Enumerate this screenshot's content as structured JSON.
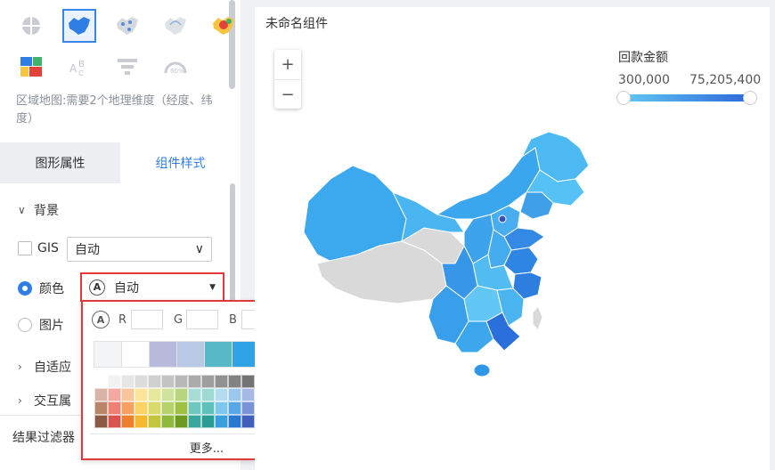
{
  "map_types": {
    "row1": [
      "region-map-icon",
      "china-map-icon",
      "point-map-icon",
      "flow-map-icon",
      "heat-map-icon"
    ],
    "row2": [
      "treemap-icon",
      "word-cloud-icon",
      "funnel-icon",
      "gauge-icon"
    ],
    "selected": "china-map-icon"
  },
  "hint": "区域地图:需要2个地理维度（经度、纬度）",
  "tabs": [
    {
      "label": "图形属性",
      "active": false
    },
    {
      "label": "组件样式",
      "active": true
    }
  ],
  "background": {
    "section_label": "背景",
    "gis_label": "GIS",
    "gis_value": "自动",
    "color_label": "颜色",
    "color_value": "自动",
    "image_label": "图片"
  },
  "sections": {
    "adaptive": "自适应",
    "interaction": "交互属",
    "result_filter": "结果过滤器"
  },
  "color_picker": {
    "r_label": "R",
    "g_label": "G",
    "b_label": "B",
    "recent_colors": [
      "#f3f4f6",
      "#ffffff",
      "#b9b9dc",
      "#b8c9e6",
      "#57b8c8",
      "#2fa3e6",
      "#ffffff",
      "#ffffff"
    ],
    "palette": [
      "#ffffff",
      "#f2f2f2",
      "#e6e6e6",
      "#dcdcdc",
      "#d0d0d0",
      "#c4c4c4",
      "#b8b8b8",
      "#ababab",
      "#9e9e9e",
      "#919191",
      "#828282",
      "#737373",
      "#636363",
      "#525252",
      "#3e3e3e",
      "#262626",
      "#000000",
      "#d9b4a6",
      "#f4a9a0",
      "#f9c59a",
      "#fde49a",
      "#e6e99b",
      "#cfe39e",
      "#b7d57c",
      "#a8dcd7",
      "#9fd9d3",
      "#b3dcf2",
      "#9cc8f0",
      "#a7b9e4",
      "#bcb4e0",
      "#c6b5e0",
      "#d9b4d7",
      "#f0b8cc",
      "#f5c5d6",
      "#b98467",
      "#ef7e73",
      "#f7a160",
      "#fcd264",
      "#d8db6a",
      "#b5d26c",
      "#9ec142",
      "#6fc8bf",
      "#5ec2ba",
      "#7ec6ec",
      "#5aa7e8",
      "#7a93d6",
      "#9b8ed3",
      "#aa8ed1",
      "#c58dc4",
      "#e98fb2",
      "#ee9fbc",
      "#8a5a44",
      "#d9534f",
      "#ef7f2f",
      "#f5b82e",
      "#c3c53a",
      "#8fb93c",
      "#6f9a1f",
      "#38a89d",
      "#2a9c93",
      "#3aa0dd",
      "#2b78d1",
      "#3f5fb8",
      "#6a5ab3",
      "#8357b0",
      "#a9579f",
      "#d6588b",
      "#db6a97"
    ],
    "more_label": "更多..."
  },
  "canvas": {
    "title": "未命名组件",
    "zoom_in": "+",
    "zoom_out": "−",
    "legend": {
      "title": "回款金额",
      "min": "300,000",
      "max": "75,205,400",
      "color_min": "#62c9f5",
      "color_max": "#2b63d8"
    }
  }
}
